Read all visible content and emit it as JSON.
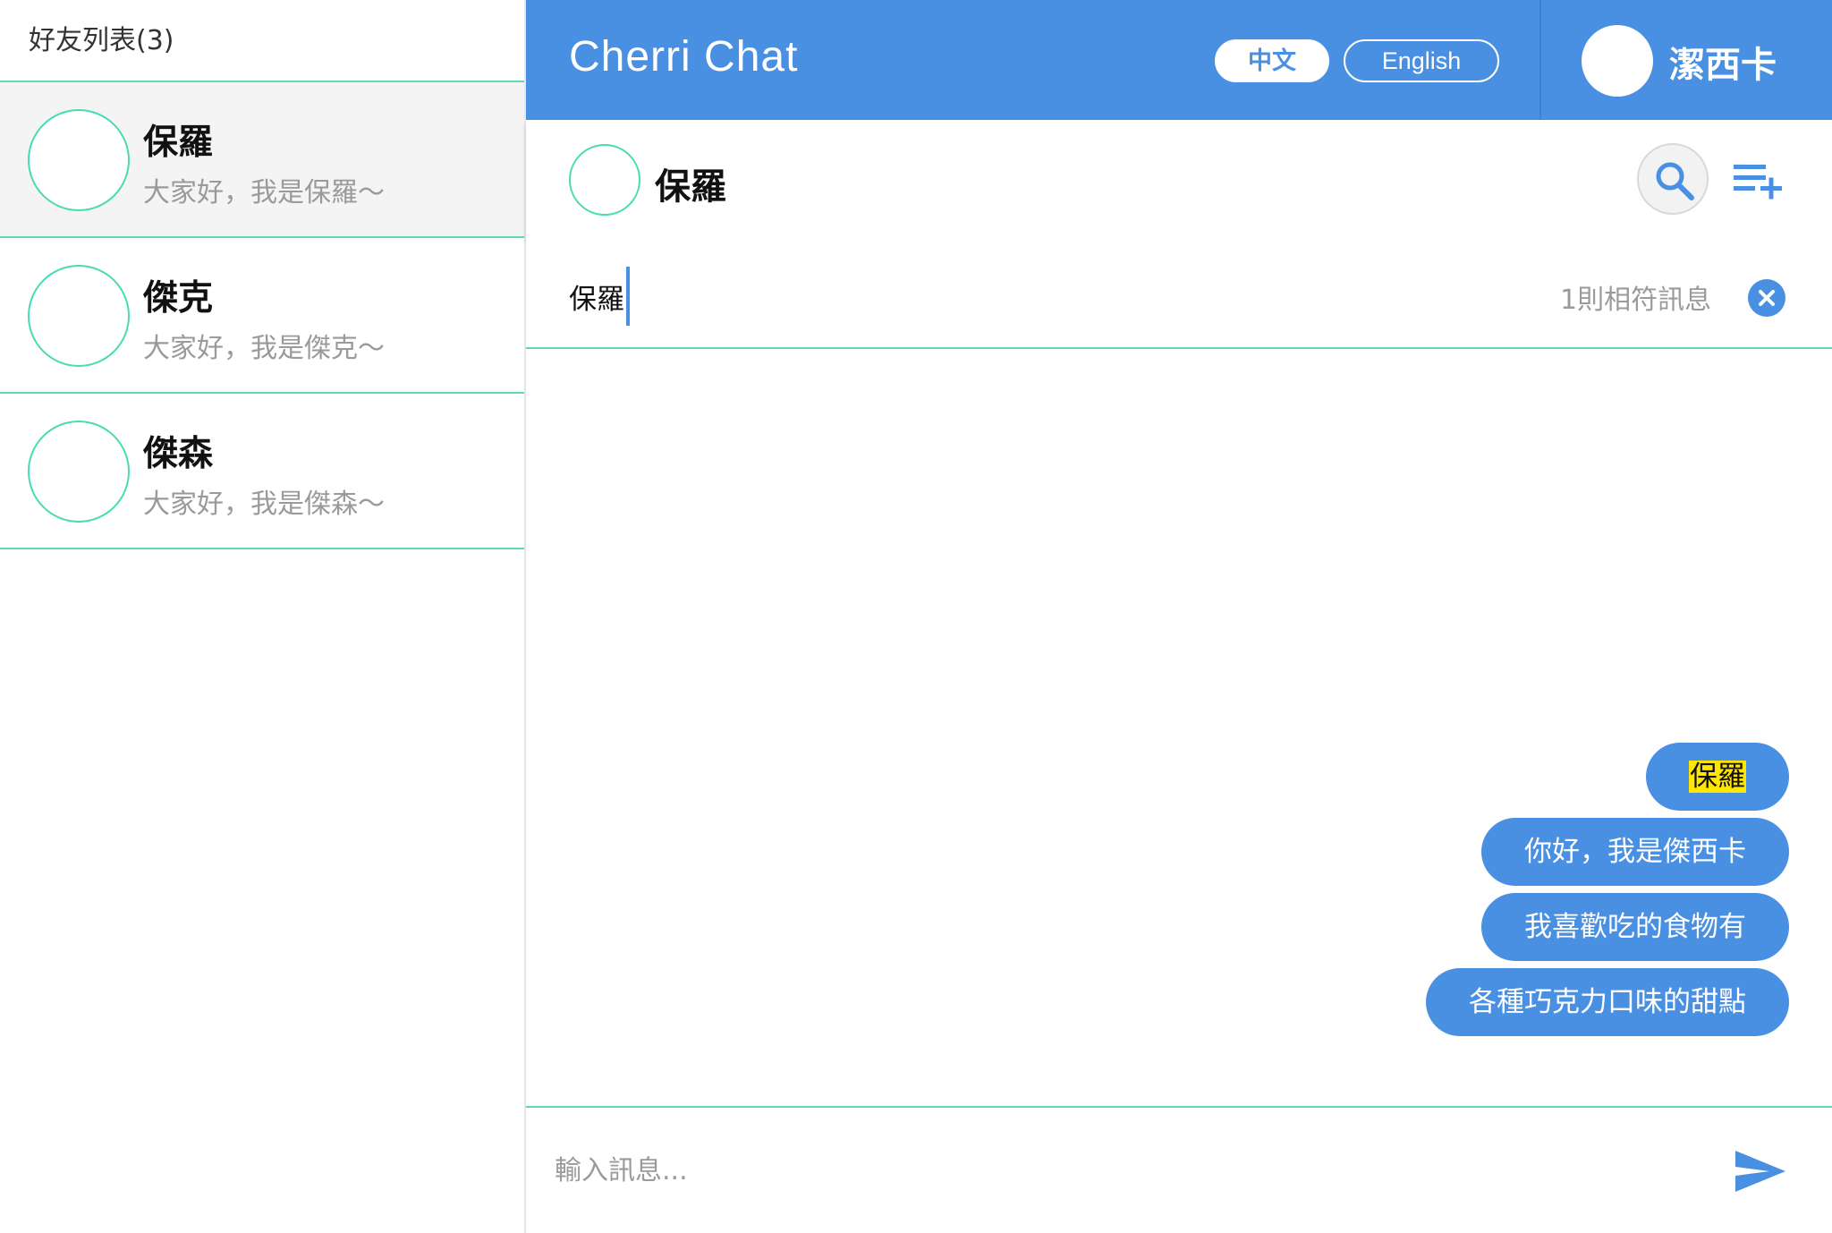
{
  "sidebar": {
    "title": "好友列表(3)",
    "friends": [
      {
        "name": "保羅",
        "status": "大家好，我是保羅～",
        "active": true
      },
      {
        "name": "傑克",
        "status": "大家好，我是傑克～",
        "active": false
      },
      {
        "name": "傑森",
        "status": "大家好，我是傑森～",
        "active": false
      }
    ]
  },
  "header": {
    "brand": "Cherri Chat",
    "languages": {
      "zh": "中文",
      "en": "English"
    },
    "current_user": "潔西卡"
  },
  "chat": {
    "contact_name": "保羅",
    "icons": {
      "search": "search-icon",
      "add": "playlist-add-icon",
      "clear": "close-circle-icon",
      "send": "send-icon"
    }
  },
  "search": {
    "value": "保羅",
    "match_count": "1則相符訊息"
  },
  "messages": [
    {
      "text": "保羅",
      "highlighted": true
    },
    {
      "text": "你好，我是傑西卡"
    },
    {
      "text": "我喜歡吃的食物有"
    },
    {
      "text": "各種巧克力口味的甜點"
    }
  ],
  "composer": {
    "placeholder": "輸入訊息..."
  },
  "colors": {
    "primary": "#4a90e2",
    "accent_border": "#5fd8bb",
    "highlight": "#ffe600"
  }
}
